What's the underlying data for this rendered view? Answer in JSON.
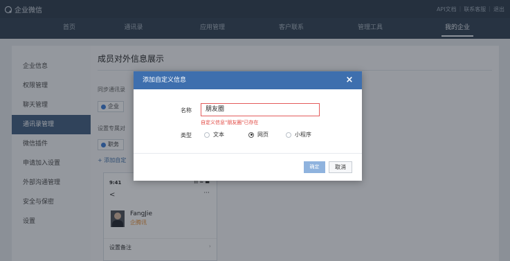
{
  "app": {
    "logo_text": "企业微信"
  },
  "top_links": [
    "API文档",
    "联系客服",
    "退出"
  ],
  "nav": {
    "items": [
      {
        "label": "首页"
      },
      {
        "label": "通讯录"
      },
      {
        "label": "应用管理"
      },
      {
        "label": "客户联系"
      },
      {
        "label": "管理工具"
      },
      {
        "label": "我的企业",
        "active": true
      }
    ]
  },
  "sidebar": {
    "items": [
      {
        "label": "企业信息"
      },
      {
        "label": "权限管理"
      },
      {
        "label": "聊天管理"
      },
      {
        "label": "通讯录管理",
        "active": true
      },
      {
        "label": "微信插件"
      },
      {
        "label": "申请加入设置"
      },
      {
        "label": "外部沟通管理"
      },
      {
        "label": "安全与保密"
      },
      {
        "label": "设置"
      }
    ]
  },
  "content": {
    "title": "成员对外信息展示",
    "sync_label": "同步通讯录",
    "sync_tag": "企业",
    "custom_label": "设置专属对",
    "custom_tag": "职务",
    "add_link": "+ 添加自定",
    "phone": {
      "time": "9:41",
      "signal": "ııl ≈ ▬",
      "back": "<",
      "more": "···",
      "name": "FangJie",
      "company": "企腾讯",
      "remark": "设置备注",
      "chevron": "›"
    }
  },
  "modal": {
    "title": "添加自定义信息",
    "close": "×",
    "name_label": "名称",
    "name_value": "朋友圈",
    "error": "自定义信息\"朋友圈\"已存在",
    "type_label": "类型",
    "types": [
      {
        "label": "文本",
        "selected": false
      },
      {
        "label": "网页",
        "selected": true
      },
      {
        "label": "小程序",
        "selected": false
      }
    ],
    "ok": "确定",
    "cancel": "取消"
  },
  "colors": {
    "header": "#2b3a4a",
    "accent": "#3e6fae",
    "error": "#e0443e"
  }
}
